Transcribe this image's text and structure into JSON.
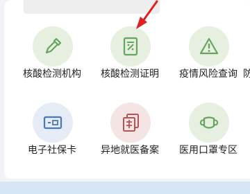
{
  "tiles_row1": [
    {
      "label": "核酸检测机构",
      "icon": "dropper-icon",
      "bg": "#e6efe0",
      "fg": "#64a55e"
    },
    {
      "label": "核酸检测证明",
      "icon": "certificate-icon",
      "bg": "#e6efe0",
      "fg": "#64a55e"
    },
    {
      "label": "疫情风险查询",
      "icon": "warning-icon",
      "bg": "#e6efe0",
      "fg": "#64a55e"
    },
    {
      "label": "防",
      "icon": "",
      "bg": "",
      "fg": ""
    }
  ],
  "tiles_row2": [
    {
      "label": "电子社保卡",
      "icon": "id-card-icon",
      "bg": "#e5ecf5",
      "fg": "#4a78b3"
    },
    {
      "label": "异地就医备案",
      "icon": "documents-icon",
      "bg": "#f4e4e4",
      "fg": "#b55353"
    },
    {
      "label": "医用口罩专区",
      "icon": "mask-icon",
      "bg": "#e6efe0",
      "fg": "#64a55e"
    }
  ],
  "annotation": {
    "arrow_color": "#e02020"
  }
}
